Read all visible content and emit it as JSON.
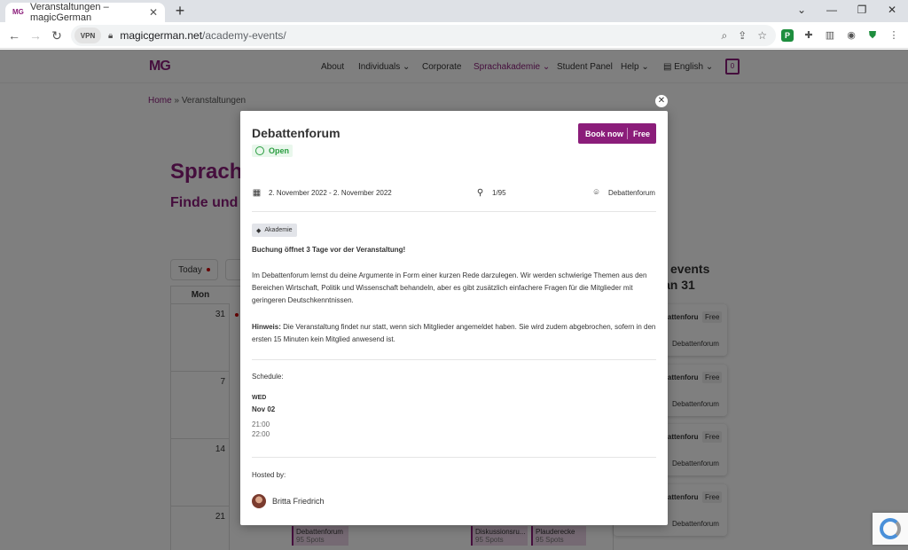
{
  "browser": {
    "tab_title": "Veranstaltungen – magicGerman",
    "tab_favicon": "MG",
    "url_host": "magicgerman.net",
    "url_path": "/academy-events/",
    "vpn_label": "VPN"
  },
  "site": {
    "logo": "MG",
    "nav": [
      "About",
      "Individuals",
      "Corporate",
      "Sprachakademie",
      "Student Panel",
      "Help",
      "English"
    ],
    "cart_count": "0",
    "breadcrumb_home": "Home",
    "breadcrumb_sep": "»",
    "breadcrumb_current": "Veranstaltungen",
    "title_partial": "Sprach",
    "subtitle_partial": "Finde und",
    "today_label": "Today",
    "cal_header": "Mon",
    "cal_days": [
      "31",
      "7",
      "14",
      "21"
    ],
    "cal_events": [
      {
        "name": "Debattenforum",
        "spots": "95 Spots"
      },
      {
        "name": "Diskussionsru...",
        "spots": "95 Spots"
      },
      {
        "name": "Plauderecke",
        "spots": "95 Spots"
      }
    ],
    "side_head_1": "events",
    "side_head_2": "an 31",
    "side_cards": [
      {
        "title": "battenforu",
        "free": "Free",
        "loc": "Debattenforum"
      },
      {
        "title": "battenforu",
        "free": "Free",
        "loc": "Debattenforum"
      },
      {
        "title": "battenforu",
        "free": "Free",
        "loc": "Debattenforum"
      },
      {
        "title": "battenforu",
        "free": "Free",
        "loc": "Debattenforum"
      }
    ]
  },
  "modal": {
    "title": "Debattenforum",
    "status": "Open",
    "book_label": "Book now",
    "book_price": "Free",
    "date_range": "2. November 2022 - 2. November 2022",
    "capacity": "1/95",
    "location": "Debattenforum",
    "tag": "Akademie",
    "booking_notice": "Buchung öffnet 3 Tage vor der Veranstaltung!",
    "description": "Im Debattenforum lernst du deine Argumente in Form einer kurzen Rede darzulegen. Wir werden schwierige Themen aus den Bereichen Wirtschaft, Politik und Wissenschaft behandeln, aber es gibt zusätzlich einfachere Fragen für die Mitglieder mit geringeren Deutschkenntnissen.",
    "hint_label": "Hinweis:",
    "hint_text": " Die Veranstaltung findet nur statt, wenn sich Mitglieder angemeldet haben. Sie wird zudem abgebrochen, sofern in den ersten 15 Minuten kein Mitglied anwesend ist.",
    "schedule_label": "Schedule:",
    "schedule_day": "WED",
    "schedule_date": "Nov 02",
    "schedule_start": "21:00",
    "schedule_end": "22:00",
    "hosted_label": "Hosted by:",
    "host_name": "Britta Friedrich"
  },
  "colors": {
    "brand": "#8b1d7a",
    "status_green": "#2a9d40"
  }
}
